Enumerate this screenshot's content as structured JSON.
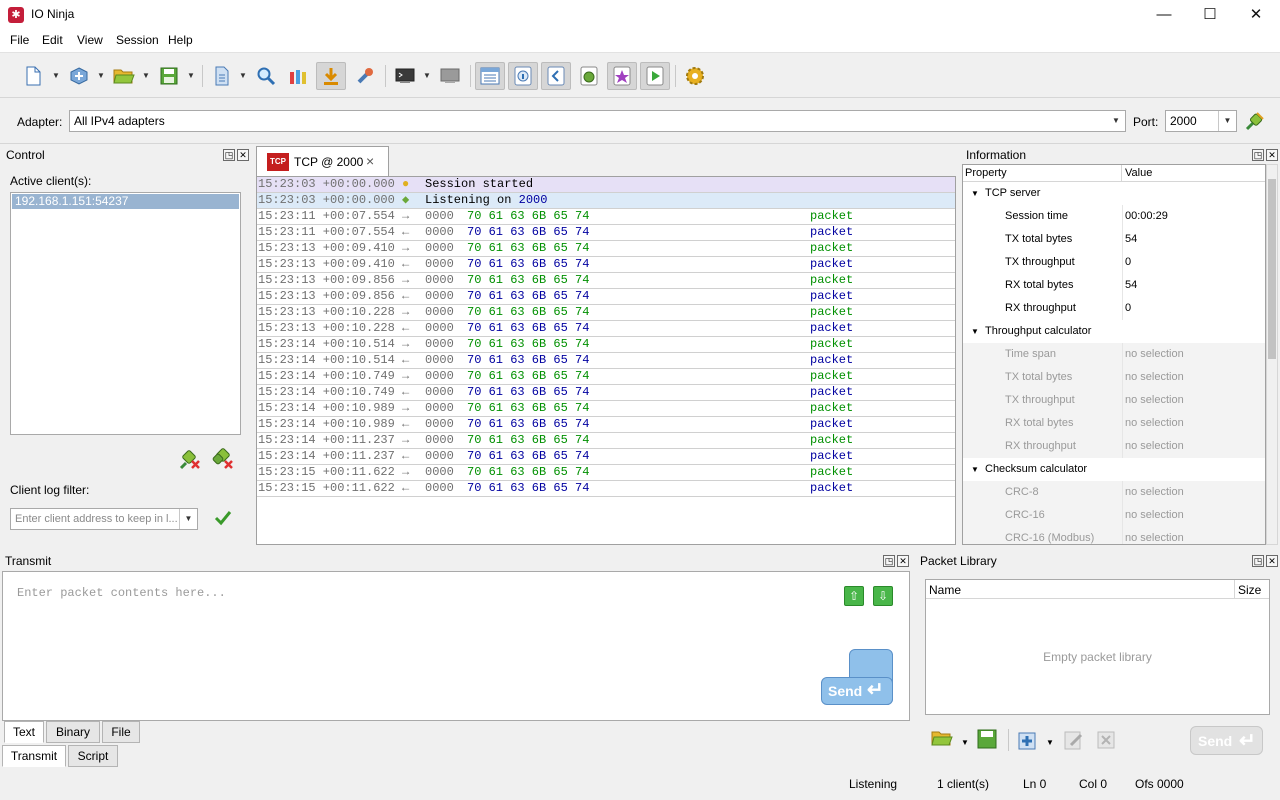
{
  "window": {
    "title": "IO Ninja",
    "minimize": "—",
    "maximize": "☐",
    "close": "✕"
  },
  "menu": [
    "File",
    "Edit",
    "View",
    "Session",
    "Help"
  ],
  "adapter": {
    "label": "Adapter:",
    "value": "All IPv4 adapters",
    "port_label": "Port:",
    "port_value": "2000"
  },
  "control": {
    "title": "Control",
    "active_clients_label": "Active client(s):",
    "clients": [
      "192.168.1.151:54237"
    ],
    "filter_label": "Client log filter:",
    "filter_placeholder": "Enter client address to keep in l..."
  },
  "session_tab": {
    "label": "TCP @ 2000",
    "close": "×"
  },
  "log": [
    {
      "time": "15:23:03 +00:00.000",
      "text": "Session started",
      "kind": "info",
      "icon": "lightbulb"
    },
    {
      "time": "15:23:03 +00:00.000",
      "text_prefix": "Listening on ",
      "text_port": "2000",
      "kind": "listen",
      "icon": "plug"
    },
    {
      "time": "15:23:11 +00:07.554",
      "dir": "→",
      "offset": "0000",
      "hex": "70 61 63 6B 65 74",
      "ascii": "packet",
      "kind": "tx"
    },
    {
      "time": "15:23:11 +00:07.554",
      "dir": "←",
      "offset": "0000",
      "hex": "70 61 63 6B 65 74",
      "ascii": "packet",
      "kind": "rx"
    },
    {
      "time": "15:23:13 +00:09.410",
      "dir": "→",
      "offset": "0000",
      "hex": "70 61 63 6B 65 74",
      "ascii": "packet",
      "kind": "tx"
    },
    {
      "time": "15:23:13 +00:09.410",
      "dir": "←",
      "offset": "0000",
      "hex": "70 61 63 6B 65 74",
      "ascii": "packet",
      "kind": "rx"
    },
    {
      "time": "15:23:13 +00:09.856",
      "dir": "→",
      "offset": "0000",
      "hex": "70 61 63 6B 65 74",
      "ascii": "packet",
      "kind": "tx"
    },
    {
      "time": "15:23:13 +00:09.856",
      "dir": "←",
      "offset": "0000",
      "hex": "70 61 63 6B 65 74",
      "ascii": "packet",
      "kind": "rx"
    },
    {
      "time": "15:23:13 +00:10.228",
      "dir": "→",
      "offset": "0000",
      "hex": "70 61 63 6B 65 74",
      "ascii": "packet",
      "kind": "tx"
    },
    {
      "time": "15:23:13 +00:10.228",
      "dir": "←",
      "offset": "0000",
      "hex": "70 61 63 6B 65 74",
      "ascii": "packet",
      "kind": "rx"
    },
    {
      "time": "15:23:14 +00:10.514",
      "dir": "→",
      "offset": "0000",
      "hex": "70 61 63 6B 65 74",
      "ascii": "packet",
      "kind": "tx"
    },
    {
      "time": "15:23:14 +00:10.514",
      "dir": "←",
      "offset": "0000",
      "hex": "70 61 63 6B 65 74",
      "ascii": "packet",
      "kind": "rx"
    },
    {
      "time": "15:23:14 +00:10.749",
      "dir": "→",
      "offset": "0000",
      "hex": "70 61 63 6B 65 74",
      "ascii": "packet",
      "kind": "tx"
    },
    {
      "time": "15:23:14 +00:10.749",
      "dir": "←",
      "offset": "0000",
      "hex": "70 61 63 6B 65 74",
      "ascii": "packet",
      "kind": "rx"
    },
    {
      "time": "15:23:14 +00:10.989",
      "dir": "→",
      "offset": "0000",
      "hex": "70 61 63 6B 65 74",
      "ascii": "packet",
      "kind": "tx"
    },
    {
      "time": "15:23:14 +00:10.989",
      "dir": "←",
      "offset": "0000",
      "hex": "70 61 63 6B 65 74",
      "ascii": "packet",
      "kind": "rx"
    },
    {
      "time": "15:23:14 +00:11.237",
      "dir": "→",
      "offset": "0000",
      "hex": "70 61 63 6B 65 74",
      "ascii": "packet",
      "kind": "tx"
    },
    {
      "time": "15:23:14 +00:11.237",
      "dir": "←",
      "offset": "0000",
      "hex": "70 61 63 6B 65 74",
      "ascii": "packet",
      "kind": "rx"
    },
    {
      "time": "15:23:15 +00:11.622",
      "dir": "→",
      "offset": "0000",
      "hex": "70 61 63 6B 65 74",
      "ascii": "packet",
      "kind": "tx"
    },
    {
      "time": "15:23:15 +00:11.622",
      "dir": "←",
      "offset": "0000",
      "hex": "70 61 63 6B 65 74",
      "ascii": "packet",
      "kind": "rx"
    }
  ],
  "information": {
    "title": "Information",
    "col_property": "Property",
    "col_value": "Value",
    "rows": [
      {
        "group": "TCP server"
      },
      {
        "prop": "Session time",
        "value": "00:00:29"
      },
      {
        "prop": "TX total bytes",
        "value": "54"
      },
      {
        "prop": "TX throughput",
        "value": "0"
      },
      {
        "prop": "RX total bytes",
        "value": "54"
      },
      {
        "prop": "RX throughput",
        "value": "0"
      },
      {
        "group": "Throughput calculator"
      },
      {
        "prop": "Time span",
        "value": "no selection",
        "disabled": true
      },
      {
        "prop": "TX total bytes",
        "value": "no selection",
        "disabled": true
      },
      {
        "prop": "TX throughput",
        "value": "no selection",
        "disabled": true
      },
      {
        "prop": "RX total bytes",
        "value": "no selection",
        "disabled": true
      },
      {
        "prop": "RX throughput",
        "value": "no selection",
        "disabled": true
      },
      {
        "group": "Checksum calculator"
      },
      {
        "prop": "CRC-8",
        "value": "no selection",
        "disabled": true
      },
      {
        "prop": "CRC-16",
        "value": "no selection",
        "disabled": true
      },
      {
        "prop": "CRC-16 (Modbus)",
        "value": "no selection",
        "disabled": true
      }
    ]
  },
  "transmit": {
    "title": "Transmit",
    "placeholder": "Enter packet contents here...",
    "send_label": "Send",
    "tabs": [
      "Text",
      "Binary",
      "File"
    ],
    "bottom_tabs": [
      "Transmit",
      "Script"
    ]
  },
  "packet_library": {
    "title": "Packet Library",
    "col_name": "Name",
    "col_size": "Size",
    "empty": "Empty packet library",
    "send_label": "Send"
  },
  "statusbar": {
    "state": "Listening",
    "clients": "1 client(s)",
    "ln": "Ln 0",
    "col": "Col 0",
    "ofs": "Ofs 0000"
  },
  "colors": {
    "tx": "#009000",
    "rx": "#0000a0",
    "info_bg": "#e6e0f6",
    "listen_bg": "#dceaf8",
    "selection": "#99b4d1"
  }
}
